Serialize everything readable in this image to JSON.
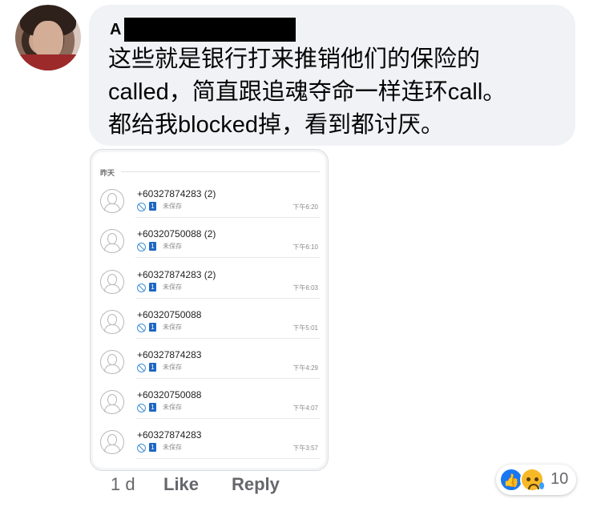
{
  "comment": {
    "author": "A",
    "text": "这些就是银行打来推销他们的保险的\ncalled，简直跟追魂夺命一样连环call。\n都给我blocked掉，看到都讨厌。",
    "time": "1 d",
    "like_label": "Like",
    "reply_label": "Reply",
    "reaction_count": "10",
    "reactions": [
      "like-icon",
      "sad-icon"
    ]
  },
  "screenshot": {
    "date_header": "昨天",
    "sim_label": "1",
    "calls": [
      {
        "number": "+60327874283 (2)",
        "status": "未保存",
        "time": "下午6:20"
      },
      {
        "number": "+60320750088 (2)",
        "status": "未保存",
        "time": "下午6:10"
      },
      {
        "number": "+60327874283 (2)",
        "status": "未保存",
        "time": "下午6:03"
      },
      {
        "number": "+60320750088",
        "status": "未保存",
        "time": "下午5:01"
      },
      {
        "number": "+60327874283",
        "status": "未保存",
        "time": "下午4:29"
      },
      {
        "number": "+60320750088",
        "status": "未保存",
        "time": "下午4:07"
      },
      {
        "number": "+60327874283",
        "status": "未保存",
        "time": "下午3:57"
      }
    ]
  },
  "colors": {
    "bubble": "#f0f2f5",
    "like_blue": "#1877f2",
    "sad_yellow": "#f7b928",
    "meta_gray": "#65676b"
  }
}
